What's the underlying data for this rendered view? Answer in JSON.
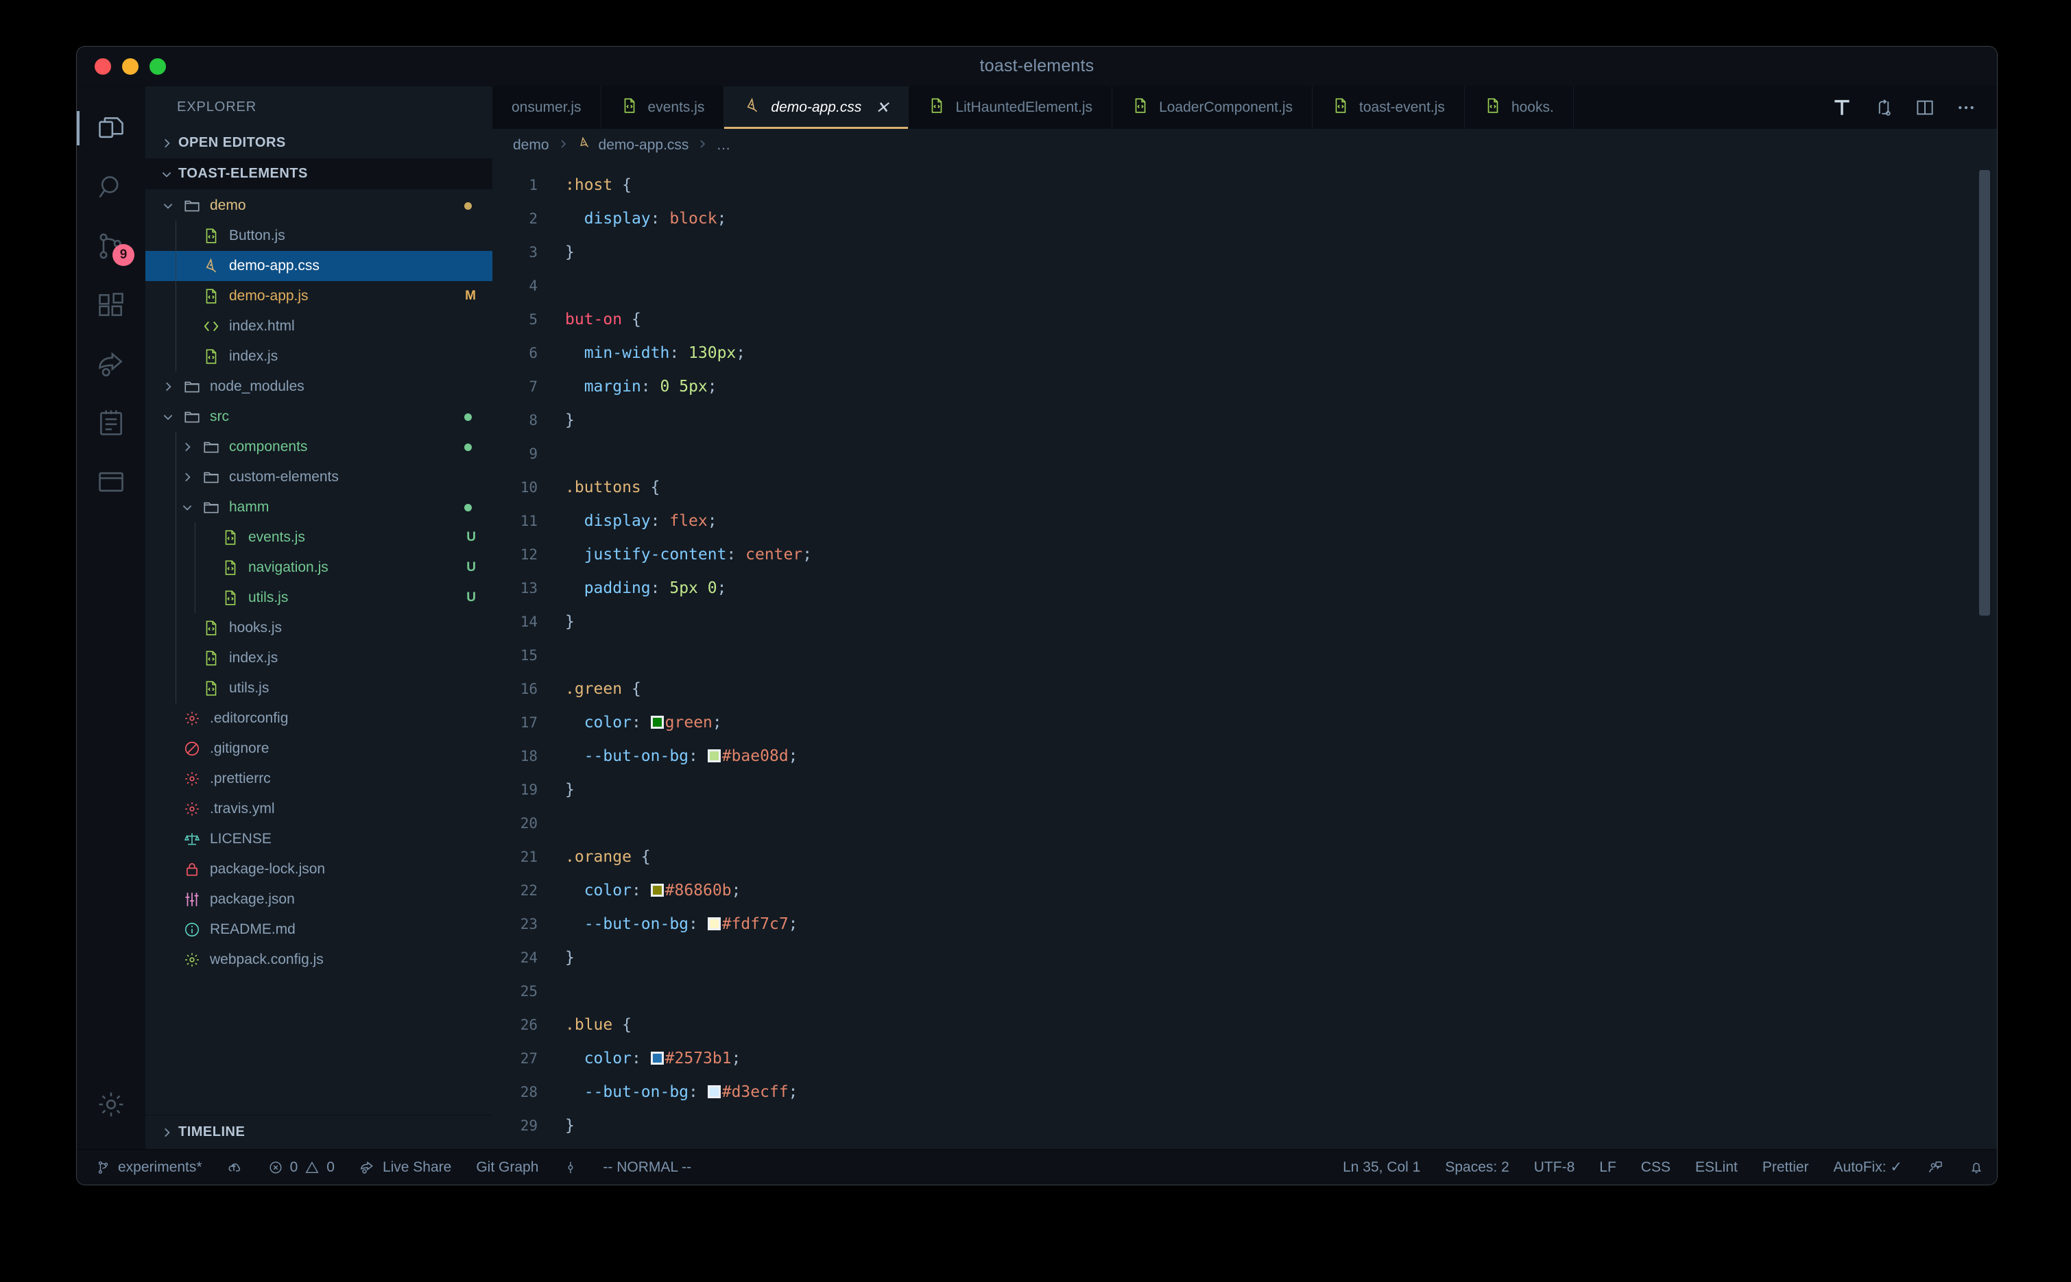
{
  "window": {
    "title": "toast-elements",
    "traffic_lights": [
      "close",
      "minimize",
      "zoom"
    ]
  },
  "activity_bar": {
    "items": [
      {
        "name": "explorer",
        "icon": "files-icon",
        "active": true,
        "badge": ""
      },
      {
        "name": "search",
        "icon": "search-icon",
        "active": false,
        "badge": ""
      },
      {
        "name": "source-control",
        "icon": "source-control-icon",
        "active": false,
        "badge": "9"
      },
      {
        "name": "extensions",
        "icon": "extensions-icon",
        "active": false,
        "badge": ""
      },
      {
        "name": "live-share",
        "icon": "live-share-icon",
        "active": false,
        "badge": ""
      },
      {
        "name": "todo",
        "icon": "notebook-icon",
        "active": false,
        "badge": ""
      },
      {
        "name": "remote",
        "icon": "window-icon",
        "active": false,
        "badge": ""
      }
    ],
    "bottom": [
      {
        "name": "manage",
        "icon": "gear-icon"
      }
    ]
  },
  "sidebar": {
    "title": "EXPLORER",
    "sections": [
      {
        "label": "OPEN EDITORS",
        "expanded": false
      },
      {
        "label": "TOAST-ELEMENTS",
        "expanded": true
      }
    ],
    "timeline_label": "TIMELINE",
    "tree": [
      {
        "label": "demo",
        "type": "folder",
        "depth": 1,
        "expanded": true,
        "color": "folder",
        "decoration": "",
        "dot": "#c9a95f"
      },
      {
        "label": "Button.js",
        "type": "js",
        "depth": 2,
        "color": "plain",
        "decoration": ""
      },
      {
        "label": "demo-app.css",
        "type": "css",
        "depth": 2,
        "color": "plain",
        "decoration": "",
        "selected": true
      },
      {
        "label": "demo-app.js",
        "type": "js",
        "depth": 2,
        "color": "modified",
        "decoration": "M"
      },
      {
        "label": "index.html",
        "type": "html",
        "depth": 2,
        "color": "plain",
        "decoration": ""
      },
      {
        "label": "index.js",
        "type": "js",
        "depth": 2,
        "color": "plain",
        "decoration": ""
      },
      {
        "label": "node_modules",
        "type": "folder",
        "depth": 1,
        "expanded": false,
        "color": "plain",
        "decoration": ""
      },
      {
        "label": "src",
        "type": "folder",
        "depth": 1,
        "expanded": true,
        "color": "green",
        "decoration": "",
        "dot": "#73c991"
      },
      {
        "label": "components",
        "type": "folder",
        "depth": 2,
        "expanded": false,
        "color": "green",
        "decoration": "",
        "dot": "#73c991"
      },
      {
        "label": "custom-elements",
        "type": "folder",
        "depth": 2,
        "expanded": false,
        "color": "plain",
        "decoration": ""
      },
      {
        "label": "hamm",
        "type": "folder",
        "depth": 2,
        "expanded": true,
        "color": "green",
        "decoration": "",
        "dot": "#73c991"
      },
      {
        "label": "events.js",
        "type": "js",
        "depth": 3,
        "color": "green",
        "decoration": "U"
      },
      {
        "label": "navigation.js",
        "type": "js",
        "depth": 3,
        "color": "green",
        "decoration": "U"
      },
      {
        "label": "utils.js",
        "type": "js",
        "depth": 3,
        "color": "green",
        "decoration": "U"
      },
      {
        "label": "hooks.js",
        "type": "js",
        "depth": 2,
        "color": "plain",
        "decoration": ""
      },
      {
        "label": "index.js",
        "type": "js",
        "depth": 2,
        "color": "plain",
        "decoration": ""
      },
      {
        "label": "utils.js",
        "type": "js",
        "depth": 2,
        "color": "plain",
        "decoration": ""
      },
      {
        "label": ".editorconfig",
        "type": "gear-red",
        "depth": 1,
        "color": "plain",
        "decoration": ""
      },
      {
        "label": ".gitignore",
        "type": "ignore",
        "depth": 1,
        "color": "plain",
        "decoration": ""
      },
      {
        "label": ".prettierrc",
        "type": "gear-red",
        "depth": 1,
        "color": "plain",
        "decoration": ""
      },
      {
        "label": ".travis.yml",
        "type": "gear-red",
        "depth": 1,
        "color": "plain",
        "decoration": ""
      },
      {
        "label": "LICENSE",
        "type": "license",
        "depth": 1,
        "color": "plain",
        "decoration": ""
      },
      {
        "label": "package-lock.json",
        "type": "lock",
        "depth": 1,
        "color": "plain",
        "decoration": ""
      },
      {
        "label": "package.json",
        "type": "sliders",
        "depth": 1,
        "color": "plain",
        "decoration": ""
      },
      {
        "label": "README.md",
        "type": "info",
        "depth": 1,
        "color": "plain",
        "decoration": ""
      },
      {
        "label": "webpack.config.js",
        "type": "gear-green",
        "depth": 1,
        "color": "plain",
        "decoration": ""
      }
    ]
  },
  "editor": {
    "tabs": [
      {
        "label": "onsumer.js",
        "icon": "js-icon",
        "active": false,
        "truncated_left": true
      },
      {
        "label": "events.js",
        "icon": "js-icon",
        "active": false
      },
      {
        "label": "demo-app.css",
        "icon": "css-icon",
        "active": true,
        "close": "✕"
      },
      {
        "label": "LitHauntedElement.js",
        "icon": "js-icon",
        "active": false
      },
      {
        "label": "LoaderComponent.js",
        "icon": "js-icon",
        "active": false
      },
      {
        "label": "toast-event.js",
        "icon": "js-icon",
        "active": false
      },
      {
        "label": "hooks.",
        "icon": "js-icon",
        "active": false,
        "truncated_right": true
      }
    ],
    "tab_actions": [
      {
        "name": "format-icon"
      },
      {
        "name": "split-compare-icon"
      },
      {
        "name": "split-editor-icon"
      },
      {
        "name": "more-actions-icon"
      }
    ],
    "breadcrumbs": [
      {
        "label": "demo",
        "icon": ""
      },
      {
        "label": "demo-app.css",
        "icon": "css-icon"
      },
      {
        "label": "…",
        "icon": ""
      }
    ],
    "code": [
      {
        "n": 1,
        "tokens": [
          {
            "t": ":host",
            "c": "sel"
          },
          {
            "t": " ",
            "c": "plain"
          },
          {
            "t": "{",
            "c": "punct"
          }
        ]
      },
      {
        "n": 2,
        "tokens": [
          {
            "t": "  ",
            "c": "plain"
          },
          {
            "t": "display",
            "c": "prop"
          },
          {
            "t": ": ",
            "c": "punct"
          },
          {
            "t": "block",
            "c": "val"
          },
          {
            "t": ";",
            "c": "punct"
          }
        ]
      },
      {
        "n": 3,
        "tokens": [
          {
            "t": "}",
            "c": "punct"
          }
        ]
      },
      {
        "n": 4,
        "tokens": []
      },
      {
        "n": 5,
        "tokens": [
          {
            "t": "but-on",
            "c": "tag"
          },
          {
            "t": " ",
            "c": "plain"
          },
          {
            "t": "{",
            "c": "punct"
          }
        ]
      },
      {
        "n": 6,
        "tokens": [
          {
            "t": "  ",
            "c": "plain"
          },
          {
            "t": "min-width",
            "c": "prop"
          },
          {
            "t": ": ",
            "c": "punct"
          },
          {
            "t": "130",
            "c": "num"
          },
          {
            "t": "px",
            "c": "num"
          },
          {
            "t": ";",
            "c": "punct"
          }
        ]
      },
      {
        "n": 7,
        "tokens": [
          {
            "t": "  ",
            "c": "plain"
          },
          {
            "t": "margin",
            "c": "prop"
          },
          {
            "t": ": ",
            "c": "punct"
          },
          {
            "t": "0",
            "c": "num"
          },
          {
            "t": " ",
            "c": "plain"
          },
          {
            "t": "5",
            "c": "num"
          },
          {
            "t": "px",
            "c": "num"
          },
          {
            "t": ";",
            "c": "punct"
          }
        ]
      },
      {
        "n": 8,
        "tokens": [
          {
            "t": "}",
            "c": "punct"
          }
        ]
      },
      {
        "n": 9,
        "tokens": []
      },
      {
        "n": 10,
        "tokens": [
          {
            "t": ".buttons",
            "c": "sel"
          },
          {
            "t": " ",
            "c": "plain"
          },
          {
            "t": "{",
            "c": "punct"
          }
        ]
      },
      {
        "n": 11,
        "tokens": [
          {
            "t": "  ",
            "c": "plain"
          },
          {
            "t": "display",
            "c": "prop"
          },
          {
            "t": ": ",
            "c": "punct"
          },
          {
            "t": "flex",
            "c": "val"
          },
          {
            "t": ";",
            "c": "punct"
          }
        ]
      },
      {
        "n": 12,
        "tokens": [
          {
            "t": "  ",
            "c": "plain"
          },
          {
            "t": "justify-content",
            "c": "prop"
          },
          {
            "t": ": ",
            "c": "punct"
          },
          {
            "t": "center",
            "c": "val"
          },
          {
            "t": ";",
            "c": "punct"
          }
        ]
      },
      {
        "n": 13,
        "tokens": [
          {
            "t": "  ",
            "c": "plain"
          },
          {
            "t": "padding",
            "c": "prop"
          },
          {
            "t": ": ",
            "c": "punct"
          },
          {
            "t": "5",
            "c": "num"
          },
          {
            "t": "px",
            "c": "num"
          },
          {
            "t": " ",
            "c": "plain"
          },
          {
            "t": "0",
            "c": "num"
          },
          {
            "t": ";",
            "c": "punct"
          }
        ]
      },
      {
        "n": 14,
        "tokens": [
          {
            "t": "}",
            "c": "punct"
          }
        ]
      },
      {
        "n": 15,
        "tokens": []
      },
      {
        "n": 16,
        "tokens": [
          {
            "t": ".green",
            "c": "sel"
          },
          {
            "t": " ",
            "c": "plain"
          },
          {
            "t": "{",
            "c": "punct"
          }
        ]
      },
      {
        "n": 17,
        "tokens": [
          {
            "t": "  ",
            "c": "plain"
          },
          {
            "t": "color",
            "c": "prop"
          },
          {
            "t": ": ",
            "c": "punct"
          },
          {
            "t": "",
            "c": "swatch",
            "swatch": "#008000"
          },
          {
            "t": "green",
            "c": "val"
          },
          {
            "t": ";",
            "c": "punct"
          }
        ]
      },
      {
        "n": 18,
        "tokens": [
          {
            "t": "  ",
            "c": "plain"
          },
          {
            "t": "--but-on-bg",
            "c": "prop"
          },
          {
            "t": ": ",
            "c": "punct"
          },
          {
            "t": "",
            "c": "swatch",
            "swatch": "#bae08d"
          },
          {
            "t": "#bae08d",
            "c": "val"
          },
          {
            "t": ";",
            "c": "punct"
          }
        ]
      },
      {
        "n": 19,
        "tokens": [
          {
            "t": "}",
            "c": "punct"
          }
        ]
      },
      {
        "n": 20,
        "tokens": []
      },
      {
        "n": 21,
        "tokens": [
          {
            "t": ".orange",
            "c": "sel"
          },
          {
            "t": " ",
            "c": "plain"
          },
          {
            "t": "{",
            "c": "punct"
          }
        ]
      },
      {
        "n": 22,
        "tokens": [
          {
            "t": "  ",
            "c": "plain"
          },
          {
            "t": "color",
            "c": "prop"
          },
          {
            "t": ": ",
            "c": "punct"
          },
          {
            "t": "",
            "c": "swatch",
            "swatch": "#86860b"
          },
          {
            "t": "#86860b",
            "c": "val"
          },
          {
            "t": ";",
            "c": "punct"
          }
        ]
      },
      {
        "n": 23,
        "tokens": [
          {
            "t": "  ",
            "c": "plain"
          },
          {
            "t": "--but-on-bg",
            "c": "prop"
          },
          {
            "t": ": ",
            "c": "punct"
          },
          {
            "t": "",
            "c": "swatch",
            "swatch": "#fdf7c7"
          },
          {
            "t": "#fdf7c7",
            "c": "val"
          },
          {
            "t": ";",
            "c": "punct"
          }
        ]
      },
      {
        "n": 24,
        "tokens": [
          {
            "t": "}",
            "c": "punct"
          }
        ]
      },
      {
        "n": 25,
        "tokens": []
      },
      {
        "n": 26,
        "tokens": [
          {
            "t": ".blue",
            "c": "sel"
          },
          {
            "t": " ",
            "c": "plain"
          },
          {
            "t": "{",
            "c": "punct"
          }
        ]
      },
      {
        "n": 27,
        "tokens": [
          {
            "t": "  ",
            "c": "plain"
          },
          {
            "t": "color",
            "c": "prop"
          },
          {
            "t": ": ",
            "c": "punct"
          },
          {
            "t": "",
            "c": "swatch",
            "swatch": "#2573b1"
          },
          {
            "t": "#2573b1",
            "c": "val"
          },
          {
            "t": ";",
            "c": "punct"
          }
        ]
      },
      {
        "n": 28,
        "tokens": [
          {
            "t": "  ",
            "c": "plain"
          },
          {
            "t": "--but-on-bg",
            "c": "prop"
          },
          {
            "t": ": ",
            "c": "punct"
          },
          {
            "t": "",
            "c": "swatch",
            "swatch": "#d3ecff"
          },
          {
            "t": "#d3ecff",
            "c": "val"
          },
          {
            "t": ";",
            "c": "punct"
          }
        ]
      },
      {
        "n": 29,
        "tokens": [
          {
            "t": "}",
            "c": "punct"
          }
        ]
      },
      {
        "n": 30,
        "tokens": []
      }
    ]
  },
  "status_bar": {
    "left": [
      {
        "name": "branch",
        "icon": "git-branch-icon",
        "label": "experiments*"
      },
      {
        "name": "sync",
        "icon": "cloud-upload-icon",
        "label": ""
      },
      {
        "name": "problems",
        "icon": "errors-icon",
        "label": "0 ⚠ 0",
        "errors": "0",
        "warnings": "0"
      },
      {
        "name": "live-share",
        "icon": "live-share-icon",
        "label": "Live Share"
      },
      {
        "name": "git-graph",
        "icon": "",
        "label": "Git Graph"
      },
      {
        "name": "git-lens",
        "icon": "gitlens-icon",
        "label": ""
      },
      {
        "name": "vim-mode",
        "icon": "",
        "label": "-- NORMAL --"
      }
    ],
    "right": [
      {
        "name": "cursor-position",
        "label": "Ln 35, Col 1"
      },
      {
        "name": "indentation",
        "label": "Spaces: 2"
      },
      {
        "name": "encoding",
        "label": "UTF-8"
      },
      {
        "name": "eol",
        "label": "LF"
      },
      {
        "name": "language-mode",
        "label": "CSS"
      },
      {
        "name": "eslint",
        "label": "ESLint"
      },
      {
        "name": "prettier",
        "label": "Prettier"
      },
      {
        "name": "autofix",
        "label": "AutoFix: ✓"
      },
      {
        "name": "feedback",
        "icon": "feedback-icon",
        "label": ""
      },
      {
        "name": "notifications",
        "icon": "bell-icon",
        "label": ""
      }
    ]
  },
  "colors": {
    "editor_bg": "#131a22",
    "panel_bg": "#0d1117",
    "selection_blue": "#0c4f86",
    "accent_gold": "#d8b271",
    "untracked_green": "#73c991",
    "modified_amber": "#e2b05d",
    "badge_pink": "#f96a8a"
  }
}
